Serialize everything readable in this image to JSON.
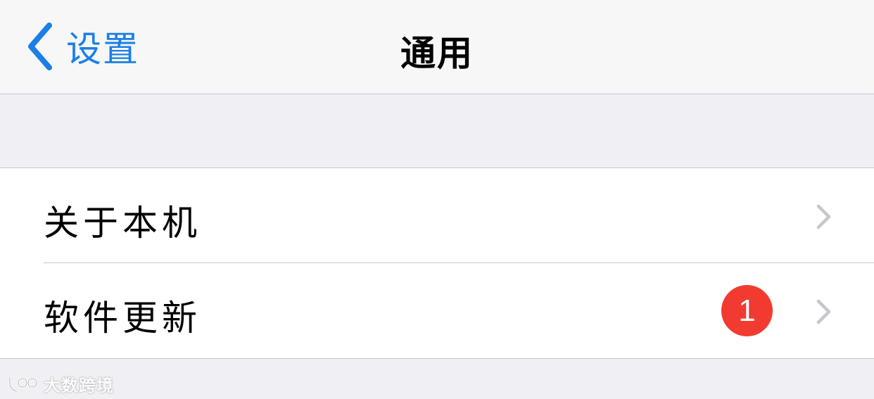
{
  "navbar": {
    "back_label": "设置",
    "title": "通用"
  },
  "settings_group": {
    "items": [
      {
        "label": "关于本机"
      },
      {
        "label": "软件更新",
        "badge": "1"
      }
    ]
  },
  "watermark": {
    "text": "大数跨境"
  },
  "colors": {
    "accent": "#1a7fe6",
    "badge": "#f23b30",
    "background": "#efeff4",
    "navbar": "#f7f7f7"
  },
  "icons": [
    "back-chevron-icon",
    "chevron-right-icon",
    "watermark-logo-icon"
  ]
}
